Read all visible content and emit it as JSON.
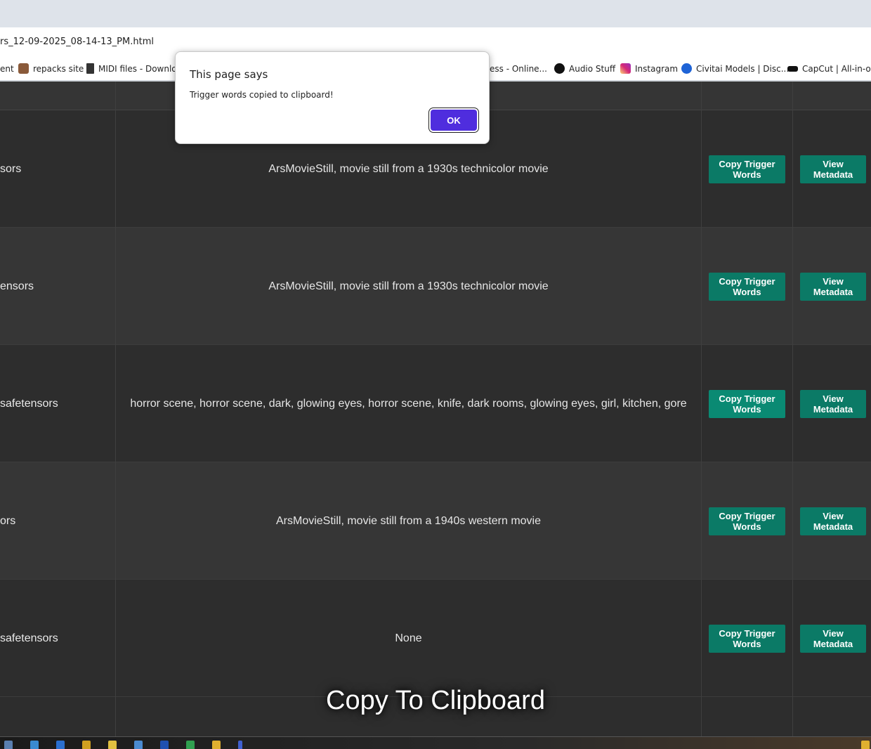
{
  "browser": {
    "address_text": "rs_12-09-2025_08-14-13_PM.html",
    "bookmarks": [
      {
        "label": "ent",
        "icon": "bookmark-icon",
        "color": "#4a4a4a"
      },
      {
        "label": "repacks site",
        "icon": "avatar-icon",
        "color": "#8a5a3a"
      },
      {
        "label": "MIDI files - Downlo...",
        "icon": "page-icon",
        "color": "#333333"
      },
      {
        "label": "ess - Online...",
        "icon": "none",
        "color": "#ffffff"
      },
      {
        "label": "Audio Stuff",
        "icon": "audio-icon",
        "color": "#111111"
      },
      {
        "label": "Instagram",
        "icon": "instagram-icon",
        "color": "#d62976"
      },
      {
        "label": "Civitai Models | Disc...",
        "icon": "civitai-icon",
        "color": "#1e63d6"
      },
      {
        "label": "CapCut | All-in-one",
        "icon": "capcut-icon",
        "color": "#111111"
      }
    ]
  },
  "table": {
    "rows": [
      {
        "file": "sors",
        "trigger": "ArsMovieStill, movie still from a 1930s technicolor movie",
        "copy_label": "Copy Trigger Words",
        "view_label": "View Metadata"
      },
      {
        "file": "ensors",
        "trigger": "ArsMovieStill, movie still from a 1930s technicolor movie",
        "copy_label": "Copy Trigger Words",
        "view_label": "View Metadata"
      },
      {
        "file": "safetensors",
        "trigger": "horror scene, horror scene, dark, glowing eyes, horror scene, knife, dark rooms, glowing eyes, girl, kitchen, gore",
        "copy_label": "Copy Trigger Words",
        "view_label": "View Metadata"
      },
      {
        "file": "ors",
        "trigger": "ArsMovieStill, movie still from a 1940s western movie",
        "copy_label": "Copy Trigger Words",
        "view_label": "View Metadata"
      },
      {
        "file": "safetensors",
        "trigger": "None",
        "copy_label": "Copy Trigger Words",
        "view_label": "View Metadata"
      }
    ]
  },
  "toast": {
    "text": "Copy To Clipboard"
  },
  "dialog": {
    "title": "This page says",
    "message": "Trigger words copied to clipboard!",
    "ok_label": "OK"
  },
  "colors": {
    "button": "#0b7a66",
    "dialog_ok": "#4f2dde"
  }
}
